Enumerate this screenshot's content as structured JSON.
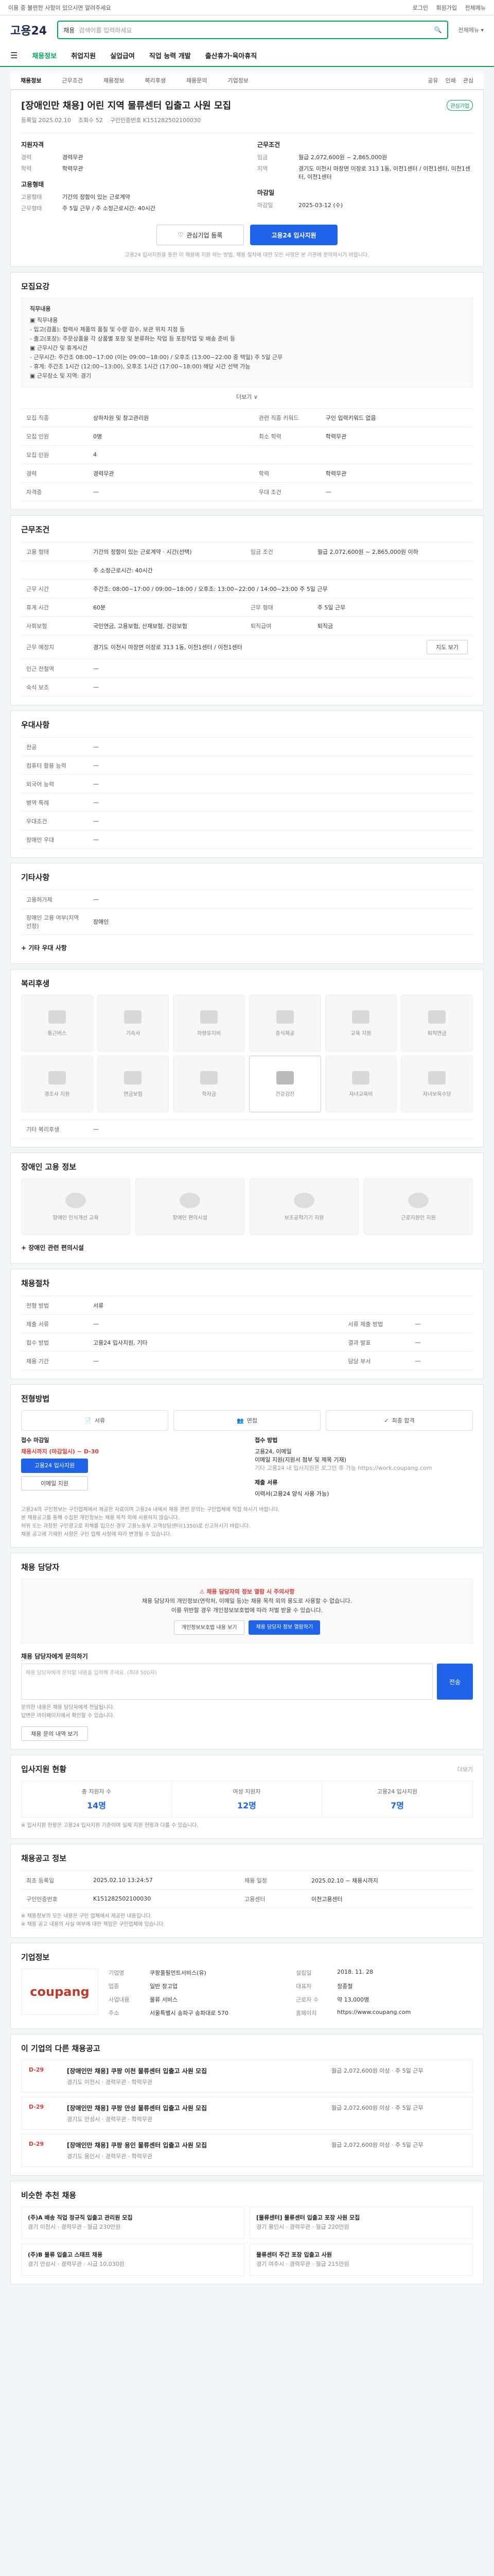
{
  "notice": {
    "text": "이용 중 불편한 사항이 있으시면 알려주세요",
    "links": [
      "로그인",
      "회원가입",
      "전체메뉴"
    ]
  },
  "header": {
    "logo": "고용24",
    "search_scope": "채용",
    "search_placeholder": "검색어를 입력하세요",
    "right": "전체메뉴 ▾"
  },
  "gnb": [
    "채용정보",
    "취업지원",
    "실업급여",
    "직업 능력 개발",
    "출산휴가·육아휴직"
  ],
  "tabs": {
    "items": [
      "채용정보",
      "근무조건",
      "채용정보",
      "복리후생",
      "채용문의",
      "기업정보"
    ],
    "actions": [
      "공유",
      "인쇄",
      "관심"
    ]
  },
  "summary": {
    "title": "[장애인만 채용] 어린 지역 물류센터 입출고 사원 모집",
    "badge": "관심기업",
    "meta": [
      "등록일 2025.02.10",
      "조회수 52",
      "구인인증번호 K151282502100030"
    ],
    "left_head": "지원자격",
    "left_rows": [
      [
        "경력",
        "경력무관"
      ],
      [
        "학력",
        "학력무관"
      ]
    ],
    "right_head": "근무조건",
    "right_rows": [
      [
        "임금",
        "월급 2,072,600원 ~ 2,865,000원"
      ],
      [
        "지역",
        "경기도 이천시 마장면 이장로 313 1동, 이천1센터 / 이천1센터, 이천1센터, 이천1센터"
      ]
    ],
    "mid_left_head": "고용형태",
    "mid_left_rows": [
      [
        "고용형태",
        "기간의 정함이 있는 근로계약"
      ],
      [
        "근무형태",
        "주 5일 근무 / 주 소정근로시간: 40시간"
      ]
    ],
    "mid_right_head": "마감일",
    "mid_right_rows": [
      [
        "마감일",
        "2025-03-12 (수)"
      ]
    ],
    "btn_interest": "관심기업 등록",
    "btn_apply": "고용24 입사지원",
    "apply_note": "고용24 입사지원을 통한 이 채용에 지원 하는 방법, 채용 절차에 대한 모든 사항은 본 기관에 문의하시기 바랍니다."
  },
  "recruit": {
    "title": "모집요강",
    "duty_head": "직무내용",
    "duty_lines": [
      "▣ 직무내용",
      "- 입고(검품): 협력사 제품의 품질 및 수량 검수, 보관 위치 지정 등",
      "- 출고(포장): 주문상품을 각 상품별 포장 및 분류하는 작업 등 포장작업 및 배송 준비 등",
      "▣ 근무시간 및 휴게시간",
      "- 근무시간: 주간조 08:00~17:00 (이는 09:00~18:00) / 오후조 (13:00~22:00 중 택일) 주 5일 근무",
      "- 휴게: 주간조 1시간 (12:00~13:00), 오후조 1시간 (17:00~18:00) 해당 시간 선택 가능",
      "▣ 근무장소 및 지역: 경기"
    ],
    "more_label": "더보기 ∨",
    "rows": [
      [
        "모집 직종",
        "상하차원 및 창고관리원",
        "관련 직종 키워드",
        "구인 입력키워드 없음"
      ],
      [
        "모집 인원",
        "0명",
        "최소 학력",
        "학력무관"
      ],
      [
        "모집 인원",
        "4",
        "",
        ""
      ],
      [
        "경력",
        "경력무관",
        "학력",
        "학력무관"
      ],
      [
        "자격증",
        "—",
        "우대 조건",
        "—"
      ]
    ]
  },
  "conditions": {
    "title": "근무조건",
    "rows": [
      [
        "고용 형태",
        "기간의 정함이 있는 근로계약 · 시간(선택)",
        "임금 조건",
        "월급 2,072,600원 ~ 2,865,000원 이하"
      ],
      [
        "",
        "주 소정근로시간: 40시간",
        "",
        ""
      ],
      [
        "근무 시간",
        "주간조: 08:00~17:00 / 09:00~18:00 / 오후조: 13:00~22:00 / 14:00~23:00 주 5일 근무",
        "",
        ""
      ],
      [
        "휴게 시간",
        "60분",
        "근무 형태",
        "주 5일 근무"
      ],
      [
        "사회보험",
        "국민연금, 고용보험, 산재보험, 건강보험",
        "퇴직급여",
        "퇴직금"
      ],
      [
        "근무 예정지",
        "경기도 이천시 마장면 이장로 313 1동, 이천1센터 / 이천1센터",
        "",
        ""
      ],
      [
        "인근 전철역",
        "—",
        "",
        ""
      ],
      [
        "숙식 보조",
        "—",
        "",
        ""
      ]
    ],
    "map_btn": "지도 보기"
  },
  "preference": {
    "title": "우대사항",
    "rows": [
      [
        "전공",
        "—"
      ],
      [
        "컴퓨터 활용 능력",
        "—"
      ],
      [
        "외국어 능력",
        "—"
      ],
      [
        "병역 특례",
        "—"
      ],
      [
        "우대조건",
        "—"
      ],
      [
        "장애인 우대",
        "—"
      ]
    ]
  },
  "other": {
    "title": "기타사항",
    "rows": [
      [
        "고용허가제",
        "—"
      ],
      [
        "장애인 고용 여부(지역 선정)",
        "장애인"
      ]
    ],
    "link": "기타 우대 사항"
  },
  "welfare": {
    "title": "복리후생",
    "items": [
      "통근버스",
      "기숙사",
      "차량유지비",
      "중식제공",
      "교육 지원",
      "퇴직연금",
      "경조사 지원",
      "연금보험",
      "학자금",
      "건강검진",
      "자녀교육비",
      "자녀보육수당"
    ],
    "etc_label": "기타 복리후생",
    "etc_value": "—"
  },
  "disability": {
    "title": "장애인 고용 정보",
    "items": [
      "장애인 인식개선 교육",
      "장애인 편의시설",
      "보조공학기기 지원",
      "근로지원인 지원"
    ],
    "link": "장애인 관련 편의시설"
  },
  "selection": {
    "title": "채용절차",
    "rows": [
      [
        "전형 방법",
        "서류",
        "",
        ""
      ],
      [
        "제출 서류",
        "—",
        "서류 제출 방법",
        "—"
      ],
      [
        "접수 방법",
        "고용24 입사지원, 기타",
        "결과 발표",
        "—"
      ],
      [
        "채용 기간",
        "—",
        "담당 부서",
        "—"
      ]
    ]
  },
  "process": {
    "title": "전형방법",
    "steps": [
      "서류",
      "면접",
      "최종 합격"
    ]
  },
  "apply": {
    "left_head": "접수 마감일",
    "deadline": "채용시까지 (마감일시) ~ D-30",
    "btn_apply": "고용24 입사지원",
    "btn_alt": "이메일 지원",
    "right_head": "접수 방법",
    "right_lines": [
      "고용24, 이메일",
      "이메일 지원(지원서 첨부 및 제목 기재)",
      "기타 고용24 내 입사지원은 로그인 후 가능 https://work.coupang.com"
    ],
    "doc_head": "제출 서류",
    "doc_line": "이력서(고용24 양식 사용 가능)",
    "notes": [
      "고용24의 구인정보는 구인업체에서 제공한 자료이며 고용24 내에서 채용 관련 문의는 구인업체에 직접 하시기 바랍니다.",
      "본 채용공고를 통해 수집된 개인정보는 채용 목적 외에 사용하지 않습니다.",
      "허위 또는 과장된 구인광고로 피해를 입으신 경우 고용노동부 고객상담센터(1350)로 신고하시기 바랍니다.",
      "채용 공고에 기재된 사항은 구인 업체 사정에 따라 변경될 수 있습니다."
    ]
  },
  "contact": {
    "title": "채용 담당자",
    "alert_head": "채용 담당자의 정보 열람 시 주의사항",
    "alert_lines": [
      "채용 담당자의 개인정보(연락처, 이메일 등)는 채용 목적 외의 용도로 사용할 수 없습니다.",
      "이를 위반할 경우 개인정보보호법에 따라 처벌 받을 수 있습니다."
    ],
    "btn_agree": "개인정보보호법 내용 보기",
    "btn_view": "채용 담당자 정보 열람하기",
    "inq_head": "채용 담당자에게 문의하기",
    "inq_placeholder": "채용 담당자에게 문의할 내용을 입력해 주세요. (최대 500자)",
    "inq_btn": "전송",
    "inq_notes": [
      "문의한 내용은 채용 담당자에게 전달됩니다.",
      "답변은 마이페이지에서 확인할 수 있습니다."
    ],
    "inq_link": "채용 문의 내역 보기"
  },
  "stats": {
    "title": "입사지원 현황",
    "more": "더보기",
    "items": [
      [
        "총 지원자 수",
        "14명"
      ],
      [
        "여성 지원자",
        "12명"
      ],
      [
        "고용24 입사지원",
        "7명"
      ]
    ],
    "note": "※ 입사지원 현황은 고용24 입사지원 기준이며 실제 지원 현황과 다를 수 있습니다."
  },
  "job_info": {
    "title": "채용공고 정보",
    "rows": [
      [
        "최초 등록일",
        "2025.02.10 13:24:57",
        "채용 일정",
        "2025.02.10 ~ 채용시까지"
      ],
      [
        "구인인증번호",
        "K151282502100030",
        "고용센터",
        "이천고용센터"
      ]
    ],
    "notes": [
      "※ 채용정보의 모든 내용은 구인 업체에서 제공한 내용입니다.",
      "※ 채용 공고 내용의 사실 여부에 대한 책임은 구인업체에 있습니다."
    ]
  },
  "company": {
    "title": "기업정보",
    "logo": "coupang",
    "rows": [
      [
        "기업명",
        "쿠팡풀필먼트서비스(유)",
        "설립일",
        "2018. 11. 28"
      ],
      [
        "업종",
        "일반 창고업",
        "대표자",
        "정종철"
      ],
      [
        "사업내용",
        "물류 서비스",
        "근로자 수",
        "약 13,000명"
      ],
      [
        "주소",
        "서울특별시 송파구 송파대로 570",
        "홈페이지",
        "https://www.coupang.com"
      ]
    ]
  },
  "related": {
    "title": "이 기업의 다른 채용공고",
    "items": [
      {
        "dday": "D-29",
        "title": "[장애인만 채용] 쿠팡 이천 물류센터 입출고 사원 모집",
        "meta": "경기도 이천시 · 경력무관 · 학력무관",
        "right": "월급 2,072,600원 이상 · 주 5일 근무"
      },
      {
        "dday": "D-29",
        "title": "[장애인만 채용] 쿠팡 안성 물류센터 입출고 사원 모집",
        "meta": "경기도 안성시 · 경력무관 · 학력무관",
        "right": "월급 2,072,600원 이상 · 주 5일 근무"
      },
      {
        "dday": "D-29",
        "title": "[장애인만 채용] 쿠팡 용인 물류센터 입출고 사원 모집",
        "meta": "경기도 용인시 · 경력무관 · 학력무관",
        "right": "월급 2,072,600원 이상 · 주 5일 근무"
      }
    ]
  },
  "reco": {
    "title": "비슷한 추천 채용",
    "items": [
      {
        "title": "(주)A 배송 직업 정규직 입출고 관리원 모집",
        "meta": "경기 이천시 · 경력무관 · 월급 230만원"
      },
      {
        "title": "[물류센터] 물류센터 입출고 포장 사원 모집",
        "meta": "경기 용인시 · 경력무관 · 월급 220만원"
      },
      {
        "title": "(주)B 물류 입출고 스태프 채용",
        "meta": "경기 안성시 · 경력무관 · 시급 10,030원"
      },
      {
        "title": "물류센터 주간 포장 입출고 사원",
        "meta": "경기 여주시 · 경력무관 · 월급 215만원"
      }
    ]
  }
}
